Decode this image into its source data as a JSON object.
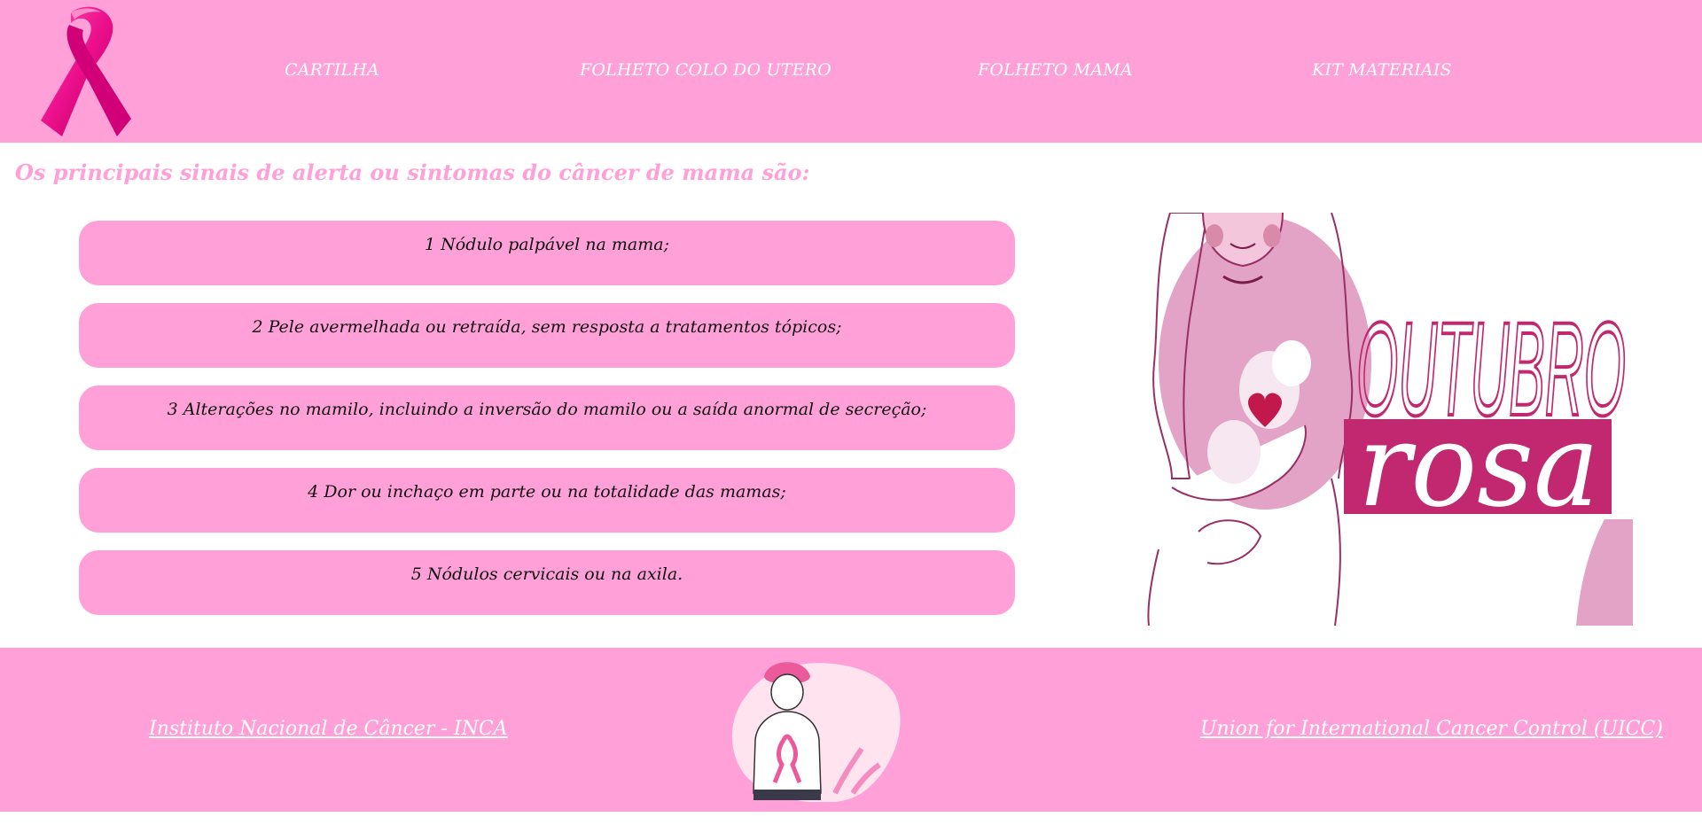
{
  "colors": {
    "accent_pink": "#ffa0d8",
    "ribbon_pink": "#ec0f8c",
    "poster_magenta": "#c2286f",
    "text_dark": "#111111",
    "white": "#ffffff"
  },
  "header": {
    "logo_icon": "pink-ribbon-icon",
    "nav": [
      {
        "label": "CARTILHA"
      },
      {
        "label": "FOLHETO COLO DO UTERO"
      },
      {
        "label": "FOLHETO MAMA"
      },
      {
        "label": "KIT MATERIAIS"
      }
    ]
  },
  "main": {
    "heading": "Os principais sinais de alerta ou sintomas do câncer de mama são:",
    "symptoms": [
      {
        "text": "1 Nódulo palpável na mama;"
      },
      {
        "text": "2 Pele avermelhada ou retraída, sem resposta a tratamentos tópicos;"
      },
      {
        "text": "3 Alterações no mamilo, incluindo a inversão do mamilo ou a saída anormal de secreção;"
      },
      {
        "text": "4 Dor ou inchaço em parte ou na totalidade das mamas;"
      },
      {
        "text": "5 Nódulos cervicais ou na axila."
      }
    ],
    "poster": {
      "line1": "OUTUBRO",
      "line2": "rosa"
    }
  },
  "footer": {
    "links": [
      {
        "label": "Instituto Nacional de Câncer - INCA"
      },
      {
        "label": "Union for International Cancer Control (UICC)"
      }
    ]
  }
}
